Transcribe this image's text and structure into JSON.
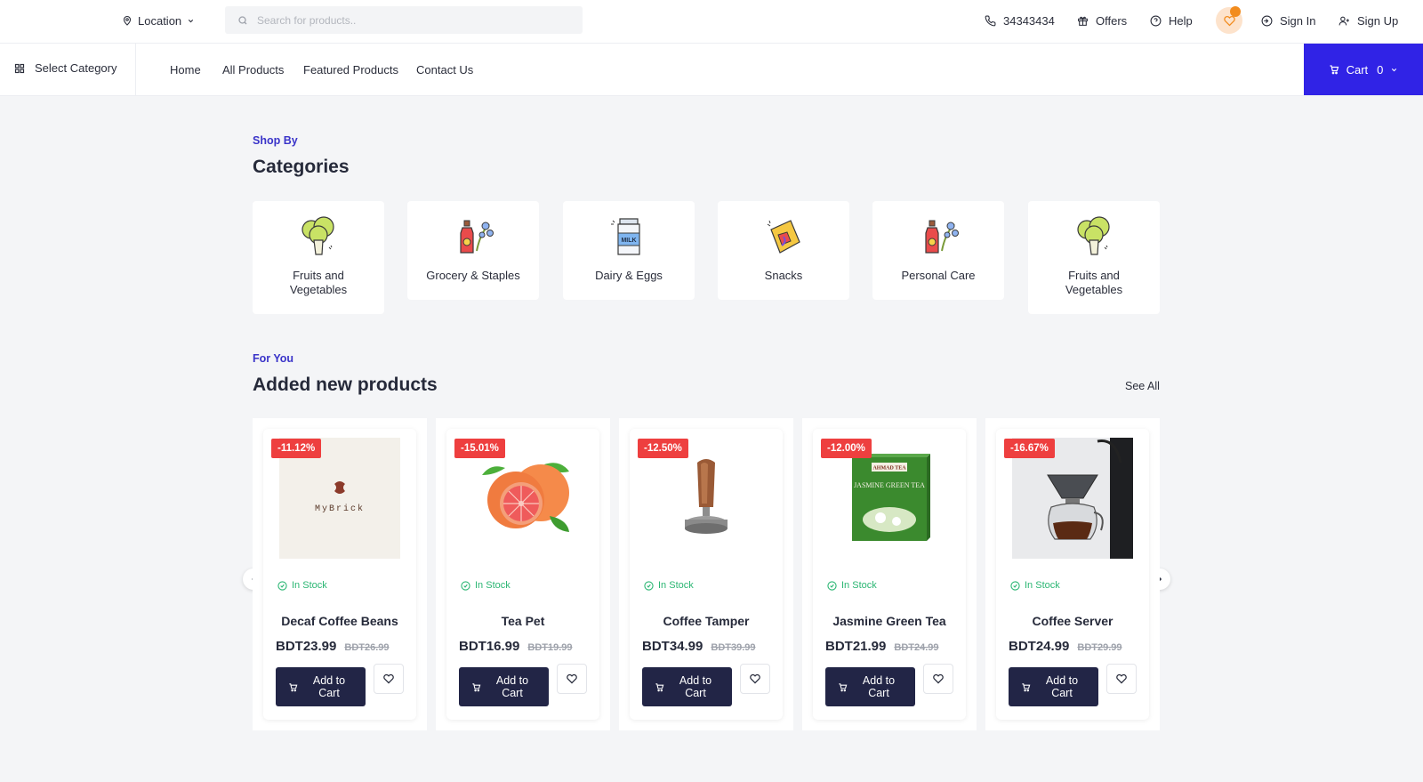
{
  "topbar": {
    "location_label": "Location",
    "search_placeholder": "Search for products..",
    "phone": "34343434",
    "offers": "Offers",
    "help": "Help",
    "sign_in": "Sign In",
    "sign_up": "Sign Up"
  },
  "nav": {
    "select_category": "Select Category",
    "links": [
      "Home",
      "All Products",
      "Featured Products",
      "Contact Us"
    ],
    "cart_label": "Cart",
    "cart_count": "0"
  },
  "categories_section": {
    "eyebrow": "Shop By",
    "title": "Categories",
    "items": [
      {
        "label": "Fruits and Vegetables",
        "icon": "broccoli-icon"
      },
      {
        "label": "Grocery & Staples",
        "icon": "oil-bottle-icon"
      },
      {
        "label": "Dairy & Eggs",
        "icon": "milk-carton-icon"
      },
      {
        "label": "Snacks",
        "icon": "snack-pack-icon"
      },
      {
        "label": "Personal Care",
        "icon": "oil-bottle-icon"
      },
      {
        "label": "Fruits and Vegetables",
        "icon": "broccoli-icon"
      }
    ]
  },
  "products_section": {
    "eyebrow": "For You",
    "title": "Added new products",
    "see_all": "See All",
    "stock_label": "In Stock",
    "add_to_cart": "Add to Cart",
    "items": [
      {
        "name": "Decaf Coffee Beans",
        "discount": "-11.12%",
        "price": "BDT23.99",
        "old_price": "BDT26.99"
      },
      {
        "name": "Tea Pet",
        "discount": "-15.01%",
        "price": "BDT16.99",
        "old_price": "BDT19.99"
      },
      {
        "name": "Coffee Tamper",
        "discount": "-12.50%",
        "price": "BDT34.99",
        "old_price": "BDT39.99"
      },
      {
        "name": "Jasmine Green Tea",
        "discount": "-12.00%",
        "price": "BDT21.99",
        "old_price": "BDT24.99"
      },
      {
        "name": "Coffee Server",
        "discount": "-16.67%",
        "price": "BDT24.99",
        "old_price": "BDT29.99"
      }
    ],
    "logo_text": "MyBrick",
    "tea_box_brand": "AHMAD TEA",
    "tea_box_text": "JASMINE GREEN TEA"
  },
  "colors": {
    "accent": "#3a34c9",
    "cart_button": "#3023e6",
    "dark_button": "#222546",
    "discount_badge": "#ee3f3f",
    "in_stock": "#2bb673",
    "wishlist_bg": "#fde3cc",
    "wishlist_dot": "#f28c1e"
  }
}
